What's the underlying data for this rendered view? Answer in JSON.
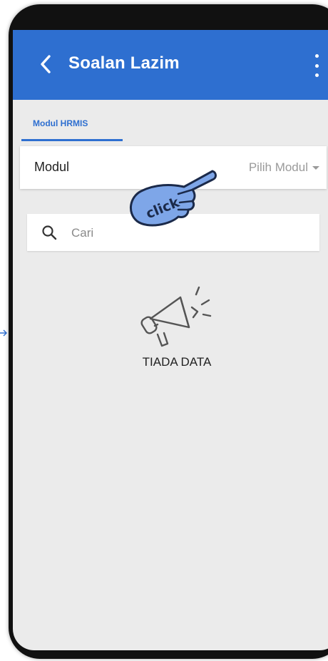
{
  "appbar": {
    "title": "Soalan Lazim",
    "back_icon": "chevron-left-icon",
    "more_icon": "more-vertical-icon",
    "color": "#2e6fd0"
  },
  "tabs": [
    {
      "label": "Modul HRMIS",
      "active": true
    }
  ],
  "modul": {
    "label": "Modul",
    "select_value": "Pilih Modul"
  },
  "search": {
    "placeholder": "Cari",
    "value": "",
    "icon": "search-icon"
  },
  "empty_state": {
    "icon": "megaphone-icon",
    "text": "TIADA DATA"
  },
  "overlay": {
    "icon": "pointing-hand-icon",
    "label": "click"
  }
}
